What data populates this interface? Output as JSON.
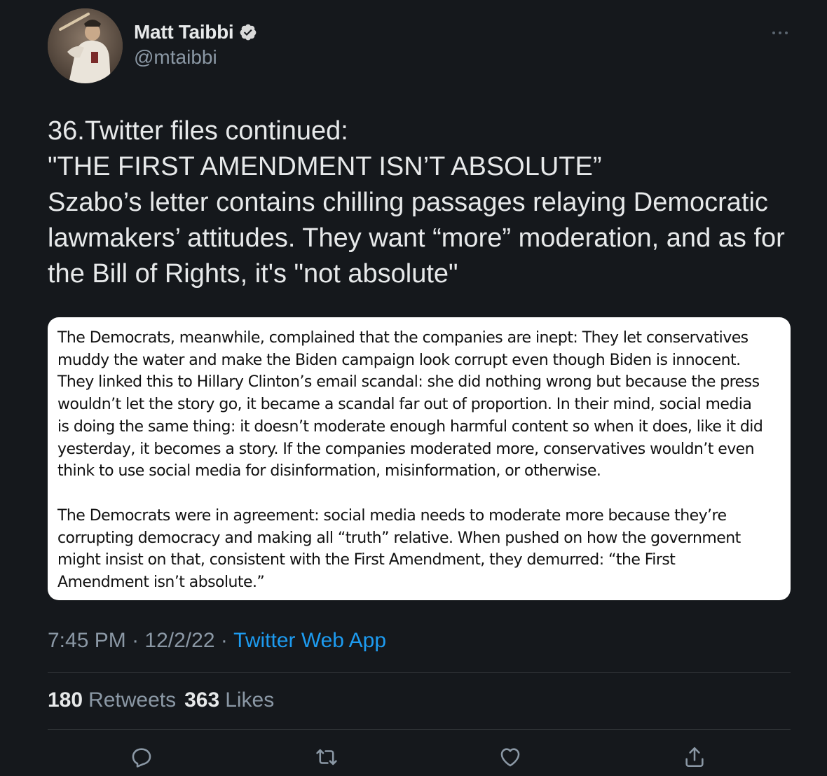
{
  "author": {
    "display_name": "Matt Taibbi",
    "handle": "@mtaibbi",
    "verified": true
  },
  "icons": {
    "verified": "verified-badge-icon",
    "more": "more-dots-icon",
    "reply": "reply-icon",
    "retweet": "retweet-icon",
    "like": "heart-icon",
    "share": "share-icon"
  },
  "tweet": {
    "text": "36.Twitter files continued:\n\"THE FIRST AMENDMENT ISN’T ABSOLUTE”\nSzabo’s letter contains chilling passages relaying Democratic lawmakers’ attitudes. They want “more” moderation, and as for the Bill of Rights, it's \"not absolute\""
  },
  "image_text": {
    "paragraph_1": "The Democrats, meanwhile, complained that the companies are inept: They let conservatives\nmuddy the water and make the Biden campaign look corrupt even though Biden is innocent.\nThey linked this to Hillary Clinton’s email scandal: she did nothing wrong but because the press\nwouldn’t let the story go, it became a scandal far out of proportion. In their mind, social media\nis doing the same thing: it doesn’t moderate enough harmful content so when it does, like it did\nyesterday, it becomes a story. If the companies moderated more, conservatives wouldn’t even\nthink to use social media for disinformation, misinformation, or otherwise.",
    "paragraph_2": "The Democrats were in agreement: social media needs to moderate more because they’re\ncorrupting democracy and making all “truth” relative. When pushed on how the government\nmight insist on that, consistent with the First Amendment, they demurred: “the First\nAmendment isn’t absolute.”"
  },
  "meta": {
    "time": "7:45 PM",
    "separator": " · ",
    "date": "12/2/22",
    "source": "Twitter Web App"
  },
  "stats": {
    "retweets_count": "180",
    "retweets_label": "Retweets",
    "likes_count": "363",
    "likes_label": "Likes"
  },
  "colors": {
    "background": "#15181c",
    "text_primary": "#e7e9ea",
    "text_secondary": "#8b98a5",
    "link": "#1d9bf0",
    "divider": "#2f3336"
  }
}
